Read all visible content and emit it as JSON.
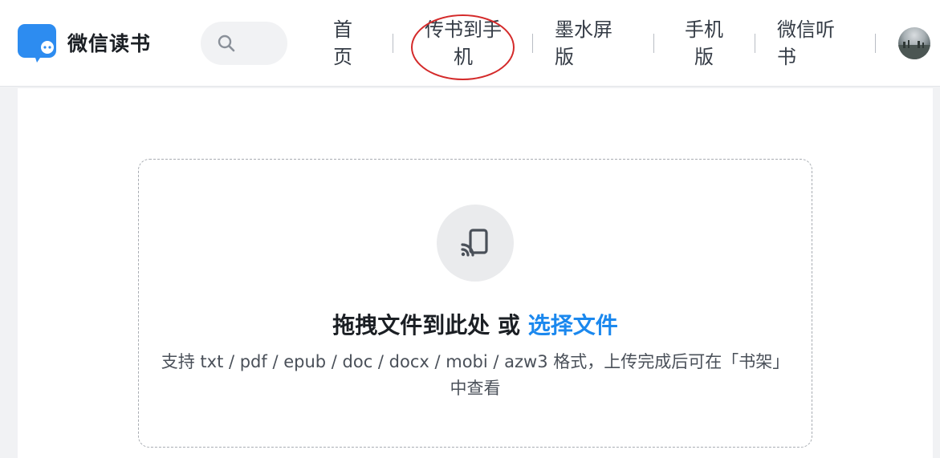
{
  "app": {
    "name": "微信读书"
  },
  "search": {
    "icon": "search-icon"
  },
  "nav": {
    "home_line1": "首",
    "home_line2": "页",
    "transfer_line1": "传书到手",
    "transfer_line2": "机",
    "eink_line1": "墨水屏",
    "eink_line2": "版",
    "mobile_line1": "手机",
    "mobile_line2": "版",
    "listen_line1": "微信听",
    "listen_line2": "书"
  },
  "upload": {
    "icon": "cast-icon",
    "title_prefix": "拖拽文件到此处 或 ",
    "title_link": "选择文件",
    "desc_line1": "支持 txt / pdf / epub / doc / docx / mobi / azw3 格式，上传完成后可在「书架」",
    "desc_line2": "中查看"
  },
  "colors": {
    "accent": "#1b88ee",
    "highlight": "#d42a2a",
    "logo": "#2d8cf0"
  }
}
